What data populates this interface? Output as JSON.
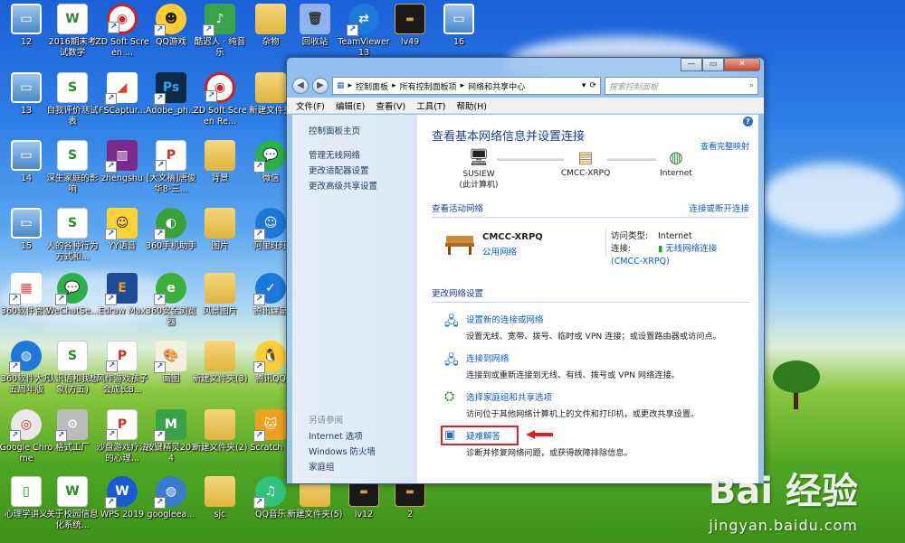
{
  "desktop": {
    "icons": [
      {
        "label": "12",
        "glyph": "▭",
        "kind": "thumb"
      },
      {
        "label": "2016期末考试数学",
        "glyph": "W",
        "kind": "doc"
      },
      {
        "label": "ZD Soft Screen ...",
        "glyph": "◉",
        "kind": "app-red"
      },
      {
        "label": "QQ游戏",
        "glyph": "☻",
        "kind": "app-qq"
      },
      {
        "label": "酷迟人 · 纯音乐",
        "glyph": "♪",
        "kind": "app-green"
      },
      {
        "label": "杂物",
        "glyph": "",
        "kind": "folder"
      },
      {
        "label": "回收站",
        "glyph": "🗑",
        "kind": "bin"
      },
      {
        "label": "TeamViewer 13",
        "glyph": "⇄",
        "kind": "app-blue"
      },
      {
        "label": "lv49",
        "glyph": "▬",
        "kind": "thumb-dark"
      },
      {
        "label": "16",
        "glyph": "▭",
        "kind": "thumb"
      },
      {
        "label": "13",
        "glyph": "▭",
        "kind": "thumb"
      },
      {
        "label": "自我评价测试表",
        "glyph": "S",
        "kind": "doc"
      },
      {
        "label": "FSCaptur...",
        "glyph": "◢",
        "kind": "app-fs"
      },
      {
        "label": "Adobe_ph...",
        "glyph": "Ps",
        "kind": "app-ps"
      },
      {
        "label": "ZD Soft Screen Re...",
        "glyph": "◉",
        "kind": "app-red"
      },
      {
        "label": "新建文件夹",
        "glyph": "",
        "kind": "folder"
      },
      {
        "label": "14",
        "glyph": "▭",
        "kind": "thumb"
      },
      {
        "label": "深生家庭的影响",
        "glyph": "S",
        "kind": "doc"
      },
      {
        "label": "zhengshu",
        "glyph": "▥",
        "kind": "app-rar"
      },
      {
        "label": "[大文稿]唐俊华8-三...",
        "glyph": "P",
        "kind": "doc-red"
      },
      {
        "label": "背景",
        "glyph": "",
        "kind": "folder"
      },
      {
        "label": "微信",
        "glyph": "💬",
        "kind": "app-wx"
      },
      {
        "label": "15",
        "glyph": "▭",
        "kind": "thumb"
      },
      {
        "label": "人的各种行为方式和...",
        "glyph": "S",
        "kind": "doc"
      },
      {
        "label": "YY语音",
        "glyph": "☺",
        "kind": "app-yy"
      },
      {
        "label": "360手机助手",
        "glyph": "◐",
        "kind": "app-360"
      },
      {
        "label": "图片",
        "glyph": "",
        "kind": "folder"
      },
      {
        "label": "阿里旺旺",
        "glyph": "☺",
        "kind": "app-blue"
      },
      {
        "label": "360软件管家",
        "glyph": "▦",
        "kind": "app-360g"
      },
      {
        "label": "WeChatSe...",
        "glyph": "💬",
        "kind": "app-wx"
      },
      {
        "label": "Edraw Max",
        "glyph": "E",
        "kind": "app-edraw"
      },
      {
        "label": "360安全浏览器",
        "glyph": "e",
        "kind": "app-360b"
      },
      {
        "label": "风景图片",
        "glyph": "",
        "kind": "folder"
      },
      {
        "label": "腾讯课堂",
        "glyph": "✓",
        "kind": "app-blue"
      },
      {
        "label": "360软件大升五周年版",
        "glyph": "◍",
        "kind": "app-blue"
      },
      {
        "label": "认识语和我想象(方五)",
        "glyph": "S",
        "kind": "doc"
      },
      {
        "label": "风作游戏孩子会成长8...",
        "glyph": "P",
        "kind": "doc-red"
      },
      {
        "label": "画图",
        "glyph": "🎨",
        "kind": "app-paint"
      },
      {
        "label": "新建文件夹(3)",
        "glyph": "",
        "kind": "folder"
      },
      {
        "label": "腾讯QQ",
        "glyph": "🐧",
        "kind": "app-qq"
      },
      {
        "label": "Google Chrome",
        "glyph": "◎",
        "kind": "app-chrome"
      },
      {
        "label": "格式工厂",
        "glyph": "⚙",
        "kind": "app-gray"
      },
      {
        "label": "沙盘游戏疗法的心理...",
        "glyph": "P",
        "kind": "doc-red"
      },
      {
        "label": "按键精灵2014",
        "glyph": "M",
        "kind": "app-green"
      },
      {
        "label": "新建文件夹(2)",
        "glyph": "",
        "kind": "folder"
      },
      {
        "label": "Scratch 2",
        "glyph": "🐱",
        "kind": "app-orange"
      },
      {
        "label": "心理学讲义",
        "glyph": "▯",
        "kind": "doc"
      },
      {
        "label": "关于校园信息化系统...",
        "glyph": "W",
        "kind": "doc"
      },
      {
        "label": "WPS 2019",
        "glyph": "W",
        "kind": "app-wps"
      },
      {
        "label": "googleea...",
        "glyph": "◍",
        "kind": "app-earth"
      },
      {
        "label": "sjc",
        "glyph": "",
        "kind": "folder"
      },
      {
        "label": "QQ音乐",
        "glyph": "♫",
        "kind": "app-qqm"
      },
      {
        "label": "新建文件夹(5)",
        "glyph": "",
        "kind": "folder"
      },
      {
        "label": "lv12",
        "glyph": "▬",
        "kind": "thumb-dark"
      },
      {
        "label": "2",
        "glyph": "▬",
        "kind": "thumb-dark"
      }
    ]
  },
  "window": {
    "address": {
      "crumbs": [
        "控制面板",
        "所有控制面板项",
        "网络和共享中心"
      ],
      "search_placeholder": "搜索控制面板"
    },
    "buttons": {
      "min": "—",
      "max": "▭",
      "close": "✕"
    },
    "menu": [
      "文件(F)",
      "编辑(E)",
      "查看(V)",
      "工具(T)",
      "帮助(H)"
    ],
    "sidebar": {
      "home": "控制面板主页",
      "items": [
        "管理无线网络",
        "更改适配器设置",
        "更改高级共享设置"
      ],
      "see_also_title": "另请参阅",
      "see_also": [
        "Internet 选项",
        "Windows 防火墙",
        "家庭组"
      ]
    },
    "main": {
      "title": "查看基本网络信息并设置连接",
      "full_map": "查看完整映射",
      "nodes": [
        {
          "label": "SUSIEW\n(此计算机)"
        },
        {
          "label": "CMCC-XRPQ"
        },
        {
          "label": "Internet"
        }
      ],
      "active_title": "查看活动网络",
      "connect_link": "连接或断开连接",
      "network_name": "CMCC-XRPQ",
      "network_kind": "公用网络",
      "access_type_label": "访问类型:",
      "access_type_value": "Internet",
      "connection_label": "连接:",
      "connection_value": "无线网络连接 (CMCC-XRPQ)",
      "settings_title": "更改网络设置",
      "tasks": [
        {
          "title": "设置新的连接或网络",
          "desc": "设置无线、宽带、拨号、临时或 VPN 连接；或设置路由器或访问点。"
        },
        {
          "title": "连接到网络",
          "desc": "连接到或重新连接到无线、有线、拨号或 VPN 网络连接。"
        },
        {
          "title": "选择家庭组和共享选项",
          "desc": "访问位于其他网络计算机上的文件和打印机，或更改共享设置。"
        },
        {
          "title": "疑难解答",
          "desc": "诊断并修复网络问题，或获得故障排除信息。"
        }
      ]
    }
  },
  "watermark": {
    "brand": "Bai 经验",
    "url": "jingyan.baidu.com"
  },
  "colors": {
    "link": "#0b5ebf",
    "highlight": "#e02020",
    "heading": "#1e3f8f"
  }
}
